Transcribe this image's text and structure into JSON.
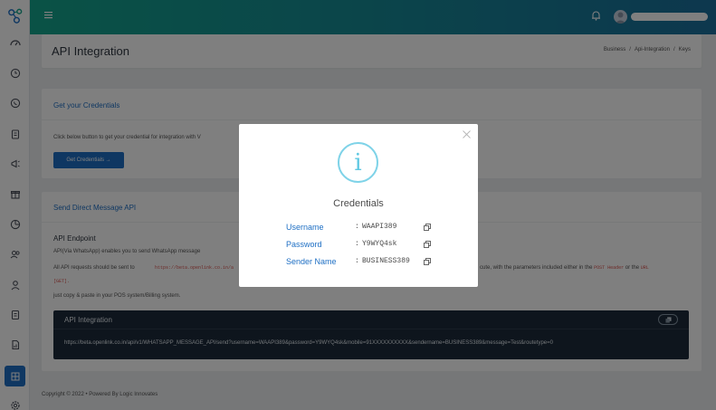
{
  "header": {
    "page_title": "API Integration",
    "breadcrumb": [
      "Business",
      "Api-Integration",
      "Keys"
    ],
    "breadcrumb_sep": "/"
  },
  "credentials_card": {
    "title": "Get your Credentials",
    "description": "Click below button to get your credential for integration with V",
    "button_label": "Get Credentials →"
  },
  "send_card": {
    "title": "Send Direct Message API",
    "endpoint_title": "API Endpoint",
    "line1": "API(Via WhatsApp) enables you to send WhatsApp message",
    "line2_prefix": "All API requests should be sent to",
    "line2_url": "https://beta.openlink.co.in/a",
    "line2_suffix": "cute, with the parameters included either in the",
    "line2_post": "POST Header",
    "line2_or": "or the",
    "line2_url_word": "URL",
    "line2_get": "[GET].",
    "line3": "just copy & paste in your POS system/Billing system.",
    "api_box_title": "API Integration",
    "api_url": "https://beta.openlink.co.in/api/v1/WHATSAPP_MESSAGE_API/send?username=WAAPI389&password=Y9WYQ4sk&mobile=91XXXXXXXXXX&sendername=BUSINESS389&message=Test&routetype=0"
  },
  "footer": {
    "text": "Copyright © 2022  • Powered By Logic Innovates"
  },
  "modal": {
    "title": "Credentials",
    "icon": "info-icon",
    "rows": [
      {
        "label": "Username",
        "value": "WAAPI389"
      },
      {
        "label": "Password",
        "value": "Y9WYQ4sk"
      },
      {
        "label": "Sender Name",
        "value": "BUSINESS389"
      }
    ],
    "colon": ":"
  },
  "colors": {
    "accent": "#1e6fc4",
    "topbar_start": "#14a58c",
    "topbar_end": "#1a6f9c",
    "info_icon": "#7fd3e8",
    "code_red": "#d9534f"
  }
}
